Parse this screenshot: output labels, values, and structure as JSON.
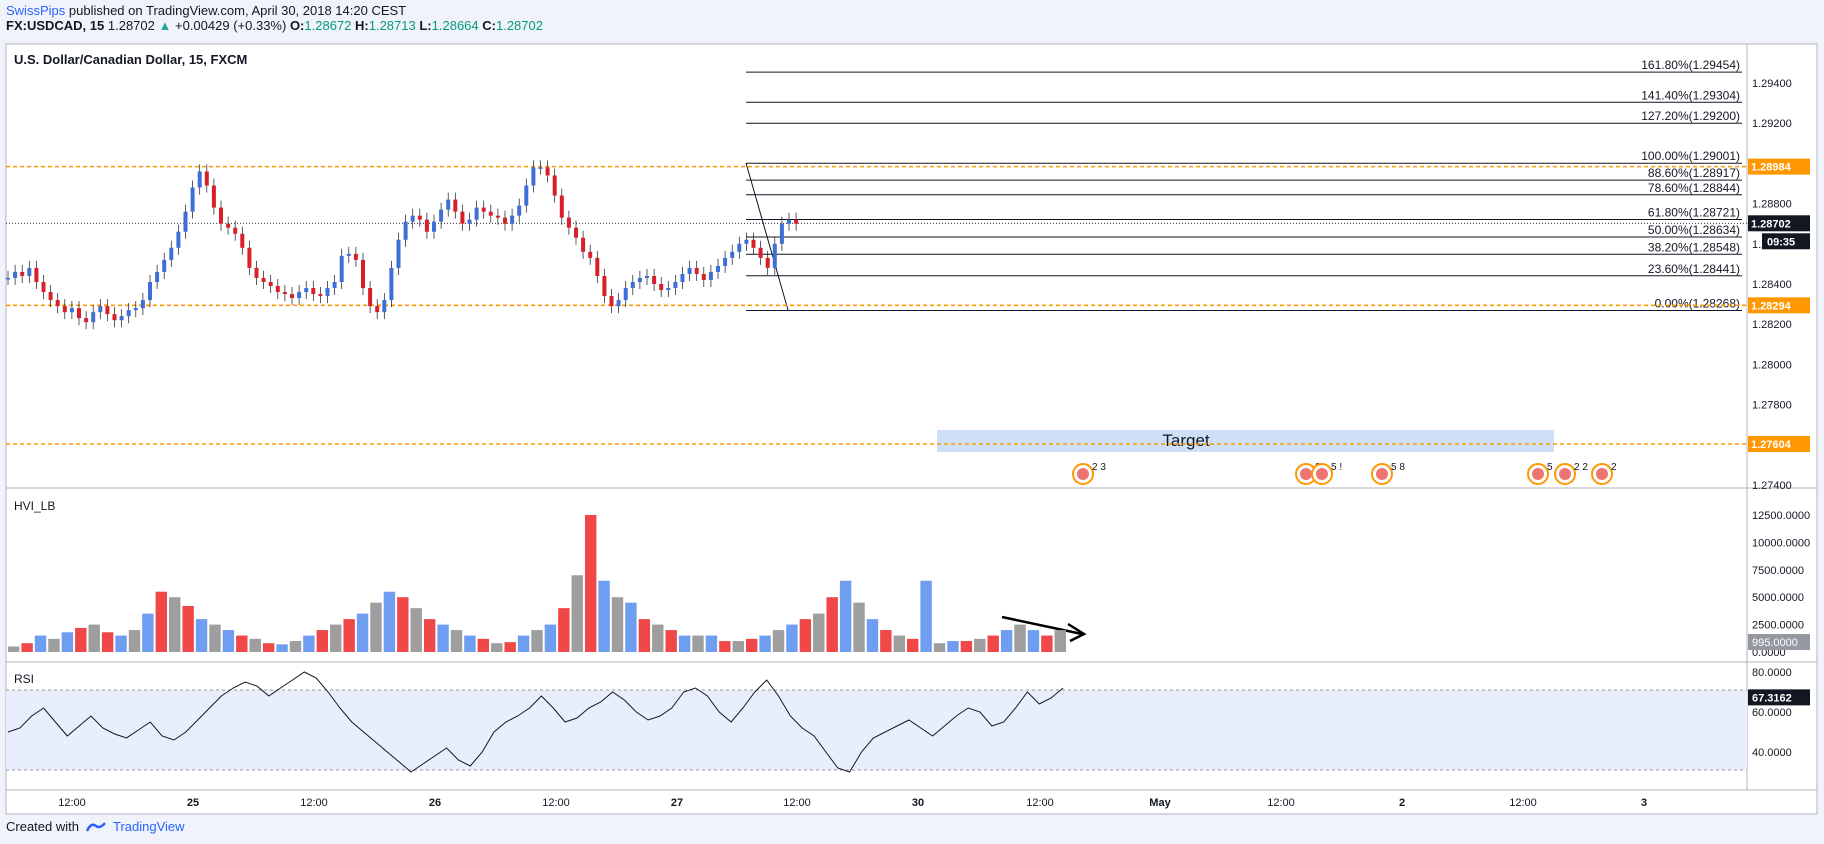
{
  "header": {
    "publisher": "SwissPips",
    "published_text": "published on TradingView.com, April 30, 2018 14:20 CEST",
    "symbol": "FX:USDCAD, 15",
    "last": "1.28702",
    "change": "+0.00429 (+0.33%)",
    "o_label": "O:",
    "o": "1.28672",
    "h_label": "H:",
    "h": "1.28713",
    "l_label": "L:",
    "l": "1.28664",
    "c_label": "C:",
    "c": "1.28702"
  },
  "footer": {
    "created_with": "Created with",
    "brand": "TradingView"
  },
  "colors": {
    "up": "#3d6fd6",
    "down": "#d9202a",
    "fib": "#131722",
    "orange": "#ff9800",
    "target": "#c9dbf6",
    "rsi_band": "#e8eefb",
    "vol_up": "#6f9ef0",
    "vol_down": "#f04848",
    "vol_grey": "#9e9e9e"
  },
  "chart_data": [
    {
      "type": "line",
      "title": "U.S. Dollar/Canadian Dollar, 15, FXCM",
      "ylim": [
        1.2735,
        1.2961
      ],
      "y_ticks": [
        "1.29400",
        "1.29200",
        "1.29000",
        "1.28800",
        "1.28600",
        "1.28400",
        "1.28200",
        "1.28000",
        "1.27800",
        "1.27400"
      ],
      "x_ticks": [
        "12:00",
        "25",
        "12:00",
        "26",
        "12:00",
        "27",
        "12:00",
        "30",
        "12:00",
        "May",
        "12:00",
        "2",
        "12:00",
        "3"
      ],
      "x": [
        0,
        1,
        2,
        3,
        4,
        5,
        6,
        7,
        8,
        9,
        10,
        11,
        12,
        13,
        14,
        15,
        16,
        17,
        18,
        19,
        20,
        21,
        22,
        23,
        24,
        25,
        26,
        27,
        28,
        29,
        30,
        31,
        32,
        33,
        34,
        35,
        36,
        37,
        38,
        39,
        40,
        41,
        42,
        43,
        44,
        45,
        46,
        47,
        48,
        49,
        50,
        51,
        52,
        53,
        54,
        55,
        56,
        57,
        58,
        59,
        60,
        61,
        62,
        63,
        64,
        65,
        66,
        67,
        68,
        69,
        70,
        71,
        72,
        73,
        74,
        75,
        76,
        77,
        78,
        79,
        80,
        81,
        82,
        83,
        84,
        85,
        86,
        87,
        88,
        89,
        90,
        91,
        92,
        93,
        94,
        95,
        96,
        97,
        98,
        99,
        100,
        101,
        102,
        103,
        104,
        105,
        106,
        107,
        108,
        109,
        110,
        111,
        112,
        113,
        114,
        115,
        116,
        117,
        118,
        119,
        120,
        121,
        122,
        123,
        124,
        125,
        126,
        127,
        128,
        129,
        130,
        131,
        132,
        133,
        134,
        135,
        136,
        137,
        138,
        139,
        140,
        141,
        142,
        143,
        144,
        145,
        146,
        147,
        148,
        149
      ],
      "series": [
        {
          "values": [
            1.2843,
            1.2846,
            1.2844,
            1.2848,
            1.2841,
            1.2836,
            1.2832,
            1.2829,
            1.2826,
            1.2828,
            1.2823,
            1.2821,
            1.2826,
            1.2829,
            1.2825,
            1.2822,
            1.2824,
            1.2827,
            1.2828,
            1.2832,
            1.2841,
            1.2846,
            1.2852,
            1.2858,
            1.2866,
            1.2876,
            1.2888,
            1.2896,
            1.2889,
            1.2878,
            1.287,
            1.2868,
            1.2865,
            1.2858,
            1.2848,
            1.2843,
            1.2841,
            1.2839,
            1.2836,
            1.2835,
            1.2833,
            1.2836,
            1.2838,
            1.2835,
            1.2834,
            1.2838,
            1.2841,
            1.2854,
            1.2855,
            1.2852,
            1.2838,
            1.2829,
            1.2826,
            1.2832,
            1.2848,
            1.2862,
            1.2871,
            1.2874,
            1.2872,
            1.2866,
            1.2871,
            1.2877,
            1.2882,
            1.2876,
            1.287,
            1.2872,
            1.2878,
            1.2876,
            1.2874,
            1.2873,
            1.287,
            1.2874,
            1.2879,
            1.2889,
            1.2898,
            1.2898,
            1.2894,
            1.2884,
            1.2873,
            1.2868,
            1.2863,
            1.2856,
            1.2853,
            1.2844,
            1.2834,
            1.2829,
            1.2832,
            1.2838,
            1.2841,
            1.2843,
            1.2844,
            1.284,
            1.2837,
            1.2838,
            1.2841,
            1.2845,
            1.2848,
            1.2845,
            1.2842,
            1.2846,
            1.2849,
            1.2853,
            1.2856,
            1.286,
            1.2862,
            1.2858,
            1.2853,
            1.2848,
            1.286,
            1.287,
            1.2872,
            1.287
          ],
          "name": ""
        },
        {
          "name": "HVI_LB",
          "values": [
            500,
            800,
            1500,
            1200,
            1800,
            2200,
            2500,
            1800,
            1500,
            2000,
            3500,
            5500,
            5000,
            4200,
            3000,
            2500,
            2000,
            1500,
            1200,
            800,
            700,
            1000,
            1500,
            2000,
            2500,
            3000,
            3500,
            4500,
            5500,
            5000,
            4000,
            3000,
            2500,
            2000,
            1500,
            1200,
            800,
            900,
            1500,
            2000,
            2500,
            4000,
            7000,
            12500,
            6500,
            5000,
            4500,
            3000,
            2500,
            2000,
            1500,
            1500,
            1500,
            1000,
            1000,
            1200,
            1500,
            2000,
            2500,
            3000,
            3500,
            5000,
            6500,
            4500,
            3000,
            2000,
            1500,
            1200,
            6500,
            800,
            1000,
            1000,
            1200,
            1500,
            2000,
            2500,
            2000,
            1500,
            2000
          ],
          "ylim": [
            0,
            13500
          ],
          "y_ticks": [
            "12500.0000",
            "10000.0000",
            "7500.0000",
            "5000.0000",
            "2500.0000",
            "0.0000"
          ],
          "last": "995.0000"
        },
        {
          "name": "RSI",
          "values": [
            50,
            52,
            58,
            62,
            55,
            48,
            53,
            58,
            52,
            49,
            47,
            51,
            55,
            48,
            46,
            50,
            56,
            62,
            68,
            72,
            75,
            73,
            68,
            72,
            76,
            80,
            77,
            70,
            62,
            55,
            50,
            45,
            40,
            35,
            30,
            34,
            38,
            42,
            36,
            33,
            40,
            50,
            55,
            58,
            62,
            68,
            62,
            55,
            57,
            62,
            65,
            70,
            66,
            60,
            56,
            58,
            62,
            70,
            72,
            68,
            60,
            55,
            62,
            70,
            76,
            68,
            58,
            52,
            48,
            40,
            32,
            30,
            40,
            47,
            50,
            53,
            56,
            52,
            48,
            53,
            58,
            62,
            60,
            53,
            55,
            62,
            70,
            64,
            67,
            72
          ],
          "ylim": [
            20,
            80
          ],
          "y_ticks": [
            "80.0000",
            "60.0000",
            "40.0000"
          ],
          "last": "67.3162"
        }
      ],
      "ylabel": "",
      "xlabel": ""
    }
  ],
  "price_badges": {
    "res": "1.28984",
    "last": "1.28702",
    "timer": "09:35",
    "sup": "1.28294",
    "target_level": "1.27604"
  },
  "fib_levels": [
    {
      "pct": "161.80%",
      "price": "1.29454"
    },
    {
      "pct": "141.40%",
      "price": "1.29304"
    },
    {
      "pct": "127.20%",
      "price": "1.29200"
    },
    {
      "pct": "100.00%",
      "price": "1.29001"
    },
    {
      "pct": "88.60%",
      "price": "1.28917"
    },
    {
      "pct": "78.60%",
      "price": "1.28844"
    },
    {
      "pct": "61.80%",
      "price": "1.28721"
    },
    {
      "pct": "50.00%",
      "price": "1.28634"
    },
    {
      "pct": "38.20%",
      "price": "1.28548"
    },
    {
      "pct": "23.60%",
      "price": "1.28441"
    },
    {
      "pct": "0.00%",
      "price": "1.28268"
    }
  ],
  "target_label": "Target",
  "events": [
    {
      "day": "30",
      "nums": "2 3"
    },
    {
      "day": "1",
      "nums": "2"
    },
    {
      "day": "1",
      "nums": "5 !"
    },
    {
      "day": "2",
      "nums": "5 8"
    },
    {
      "day": "2",
      "nums": "5"
    },
    {
      "day": "2",
      "nums": "2 2"
    },
    {
      "day": "3",
      "nums": "2"
    }
  ]
}
